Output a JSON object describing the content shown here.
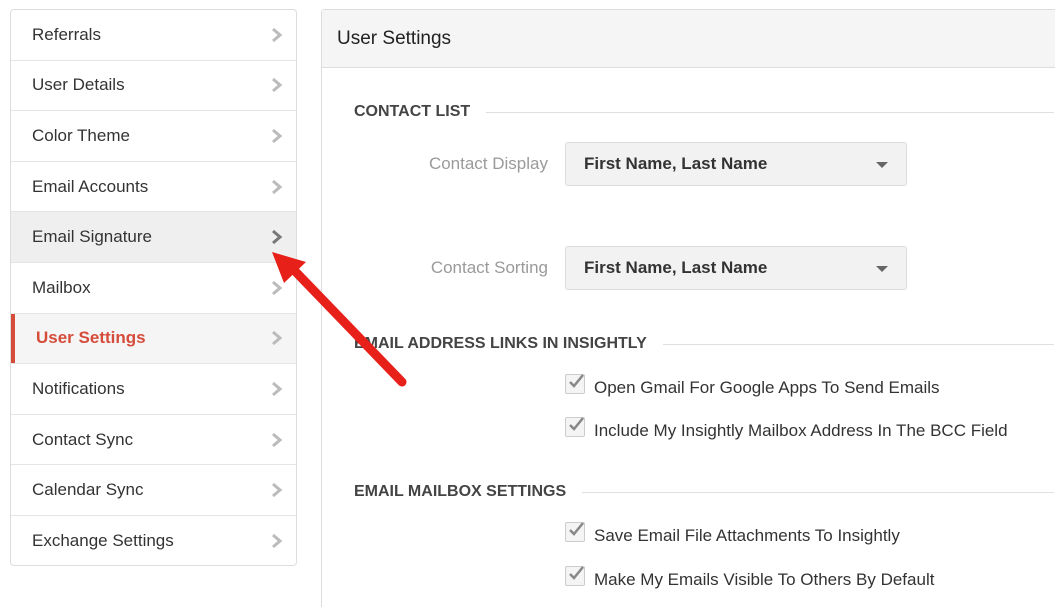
{
  "sidebar": {
    "items": [
      {
        "label": "Referrals"
      },
      {
        "label": "User Details"
      },
      {
        "label": "Color Theme"
      },
      {
        "label": "Email Accounts"
      },
      {
        "label": "Email Signature"
      },
      {
        "label": "Mailbox"
      },
      {
        "label": "User Settings"
      },
      {
        "label": "Notifications"
      },
      {
        "label": "Contact Sync"
      },
      {
        "label": "Calendar Sync"
      },
      {
        "label": "Exchange Settings"
      }
    ],
    "active_item": "User Settings",
    "highlighted_item": "Email Signature"
  },
  "main": {
    "title": "User Settings",
    "contact_list": {
      "heading": "CONTACT LIST",
      "display_label": "Contact Display",
      "display_value": "First Name, Last Name",
      "sorting_label": "Contact Sorting",
      "sorting_value": "First Name, Last Name"
    },
    "email_links": {
      "heading": "EMAIL ADDRESS LINKS IN INSIGHTLY",
      "open_gmail": "Open Gmail For Google Apps To Send Emails",
      "include_bcc": "Include My Insightly Mailbox Address In The BCC Field"
    },
    "mailbox_settings": {
      "heading": "EMAIL MAILBOX SETTINGS",
      "save_attachments": "Save Email File Attachments To Insightly",
      "visible_to_others": "Make My Emails Visible To Others By Default"
    }
  },
  "colors": {
    "accent": "#d64c3b",
    "annotation_arrow": "#e8201a"
  }
}
